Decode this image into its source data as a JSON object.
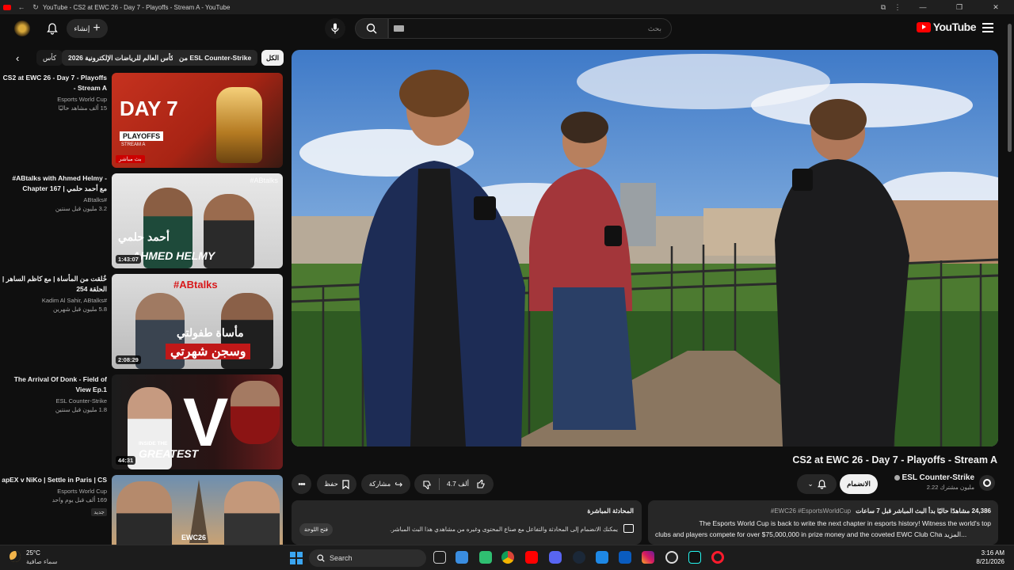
{
  "window": {
    "title": "YouTube - CS2 at EWC 26 - Day 7 - Playoffs - Stream A - YouTube"
  },
  "header": {
    "create_label": "إنشاء",
    "search_placeholder": "بحث",
    "logo_text": "YouTube"
  },
  "chips": [
    "الكل",
    "من ESL Counter-Strike",
    "كأس العالم للرياضات الإلكترونية 2026",
    "كأس"
  ],
  "recommendations": [
    {
      "title": "CS2 at EWC 26 - Day 7 - Playoffs - Stream A",
      "channel": "Esports World Cup",
      "views": "15 ألف مشاهد حاليًا",
      "badge": "بث مباشر",
      "thumb_text": [
        "DAY 7",
        "PLAYOFFS",
        "STREAM A"
      ]
    },
    {
      "title": "#ABtalks with Ahmed Helmy - Chapter 167 | مع أحمد حلمي",
      "channel": "ABtalks#",
      "views": "3.2 مليون  قبل سنتين",
      "duration": "1:43:07",
      "thumb_text": [
        "#ABtalks",
        "أحمد حلمي",
        "AHMED HELMY"
      ]
    },
    {
      "title": "خُلقت من المأساة | مع كاظم الساهر | الحلقة 254",
      "channel": "Kadim Al Sahir, ABtalks#",
      "views": "5.8 مليون  قبل شهرين",
      "duration": "2:08:29",
      "thumb_text": [
        "#ABtalks",
        "مأساة طفولتي",
        "وسجن شهرتي"
      ]
    },
    {
      "title": "The Arrival Of Donk - Field of View Ep.1",
      "channel": "ESL Counter-Strike",
      "views": "1.8 مليون  قبل سنتين",
      "duration": "44:31",
      "thumb_text": [
        "V",
        "INSIDE THE",
        "GREATEST"
      ]
    },
    {
      "title": "apEX v NiKo | Settle in Paris | CS",
      "channel": "Esports World Cup",
      "views": "169 ألف  قبل يوم واحد",
      "badge": "جديد",
      "thumb_text": [
        "EWC26"
      ]
    }
  ],
  "video": {
    "title": "CS2 at EWC 26 - Day 7 - Playoffs - Stream A",
    "channel": "ESL Counter-Strike",
    "subscribers": "2.22 مليون مشترك",
    "join_label": "الانضمام",
    "likes": "4.7 ألف",
    "share_label": "مشاركة",
    "save_label": "حفظ"
  },
  "description": {
    "stats": "24,386 مشاهدًا حاليًا  بدأ البث المباشر قبل 7 ساعات",
    "hashtags": "#EWC26 #EsportsWorldCup",
    "line1": "The Esports World Cup is back to write the next chapter in esports history! Witness the world's top",
    "line2": "...المزيد   clubs and players compete for over $75,000,000 in prize money and the coveted EWC Club Cha"
  },
  "live_chat": {
    "title": "المحادثة المباشرة",
    "text": "يمكنك الانضمام إلى المحادثة والتفاعل مع صناع المحتوى وغيره من مشاهدي هذا البث المباشر.",
    "open_label": "فتح اللوحة"
  },
  "taskbar": {
    "weather_temp": "25°C",
    "weather_text": "سماء صافية",
    "search_label": "Search",
    "time": "3:16 AM",
    "date": "8/21/2026"
  },
  "colors": {
    "accent": "#ff0000",
    "bg": "#0f0f0f",
    "surface": "#272727"
  }
}
